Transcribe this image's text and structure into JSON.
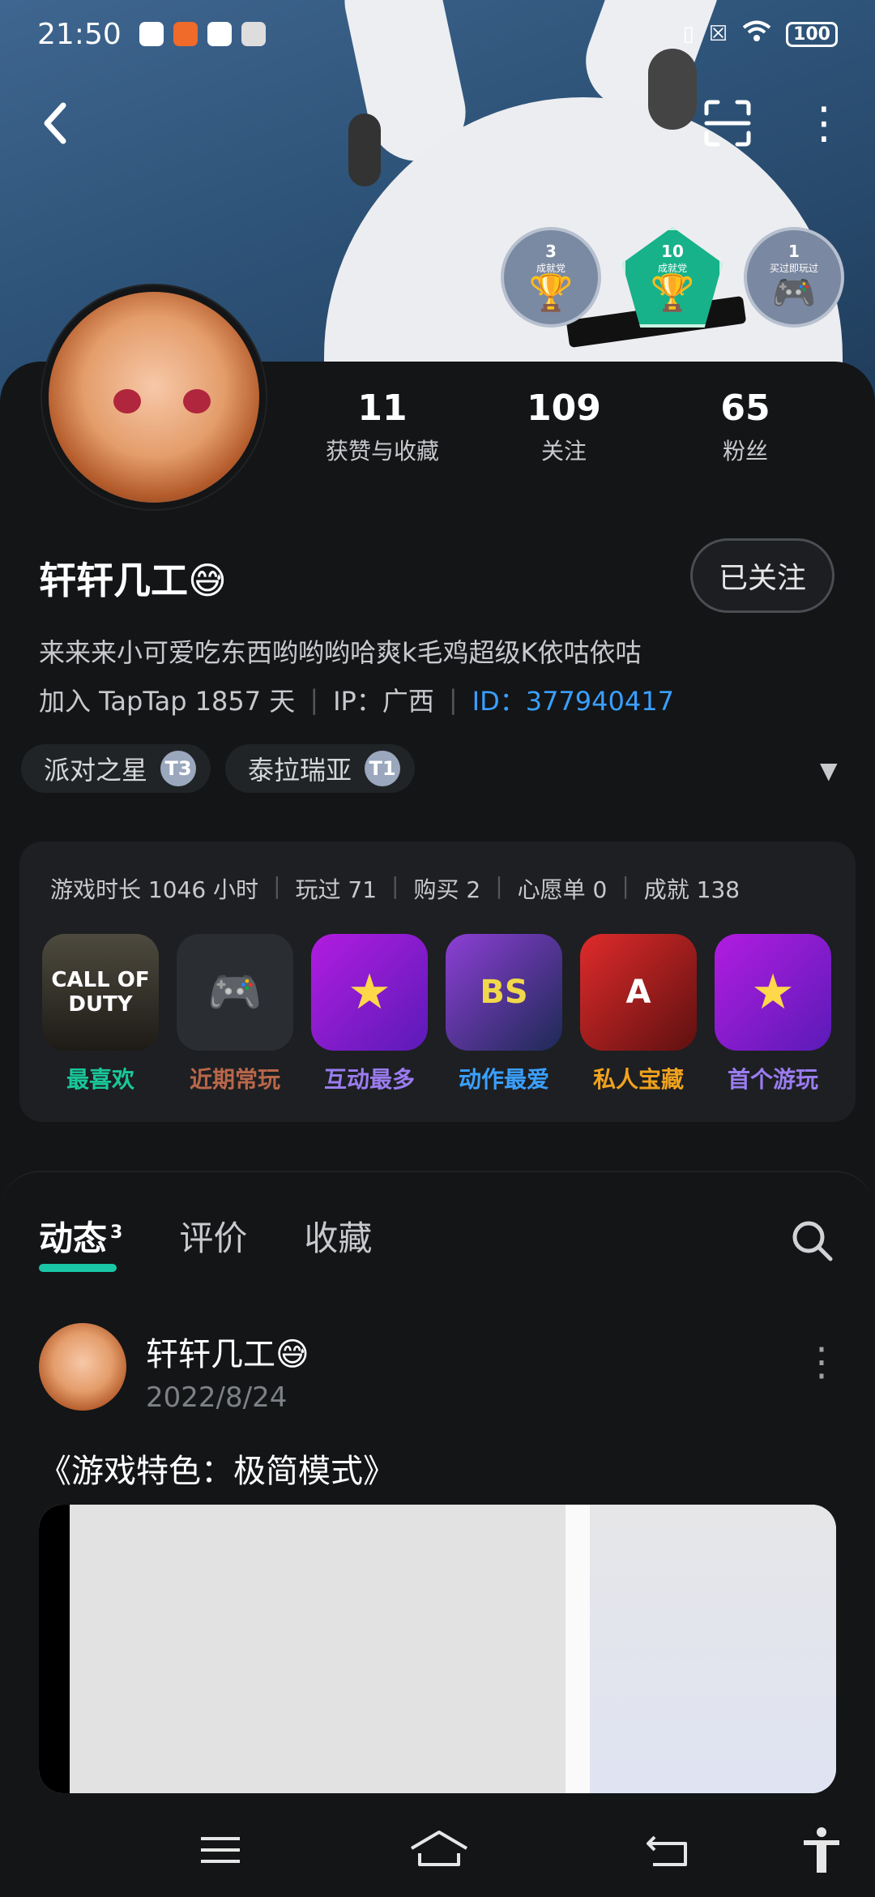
{
  "status_bar": {
    "time": "21:50",
    "battery": "100"
  },
  "profile": {
    "username": "轩轩几工😅",
    "follow_button": "已关注",
    "bio": "来来来小可爱吃东西哟哟哟哈爽k毛鸡超级K依咕依咕",
    "join": "加入 TapTap 1857 天",
    "ip": "IP：广西",
    "id": "ID：377940417",
    "stats": [
      {
        "value": "11",
        "label": "获赞与收藏"
      },
      {
        "value": "109",
        "label": "关注"
      },
      {
        "value": "65",
        "label": "粉丝"
      }
    ],
    "badges": [
      {
        "count": "3",
        "label": "成就党"
      },
      {
        "count": "10",
        "label": "成就党"
      },
      {
        "count": "1",
        "label": "买过即玩过"
      }
    ],
    "tags": [
      {
        "name": "派对之星",
        "level": "T3"
      },
      {
        "name": "泰拉瑞亚",
        "level": "T1"
      }
    ]
  },
  "games": {
    "summary": [
      "游戏时长 1046 小时",
      "玩过 71",
      "购买 2",
      "心愿单 0",
      "成就 138"
    ],
    "items": [
      {
        "icon_text": "CALL OF DUTY",
        "label": "最喜欢"
      },
      {
        "icon_text": "🎮",
        "label": "近期常玩"
      },
      {
        "icon_text": "★",
        "label": "互动最多"
      },
      {
        "icon_text": "BS",
        "label": "动作最爱"
      },
      {
        "icon_text": "A",
        "label": "私人宝藏"
      },
      {
        "icon_text": "★",
        "label": "首个游玩"
      }
    ]
  },
  "feed": {
    "tabs": [
      {
        "label": "动态",
        "sup": "3"
      },
      {
        "label": "评价"
      },
      {
        "label": "收藏"
      }
    ],
    "post": {
      "author": "轩轩几工😅",
      "date": "2022/8/24",
      "title": "《游戏特色：极简模式》"
    }
  },
  "icons": {
    "back": "back-arrow-icon",
    "scan": "scan-icon",
    "more": "more-vertical-icon",
    "search": "search-icon",
    "menu": "menu-icon",
    "home": "home-icon",
    "return": "return-icon",
    "accessibility": "accessibility-icon"
  },
  "colors": {
    "accent": "#19c7a6",
    "id_link": "#3aa0ff",
    "background": "#131517"
  }
}
